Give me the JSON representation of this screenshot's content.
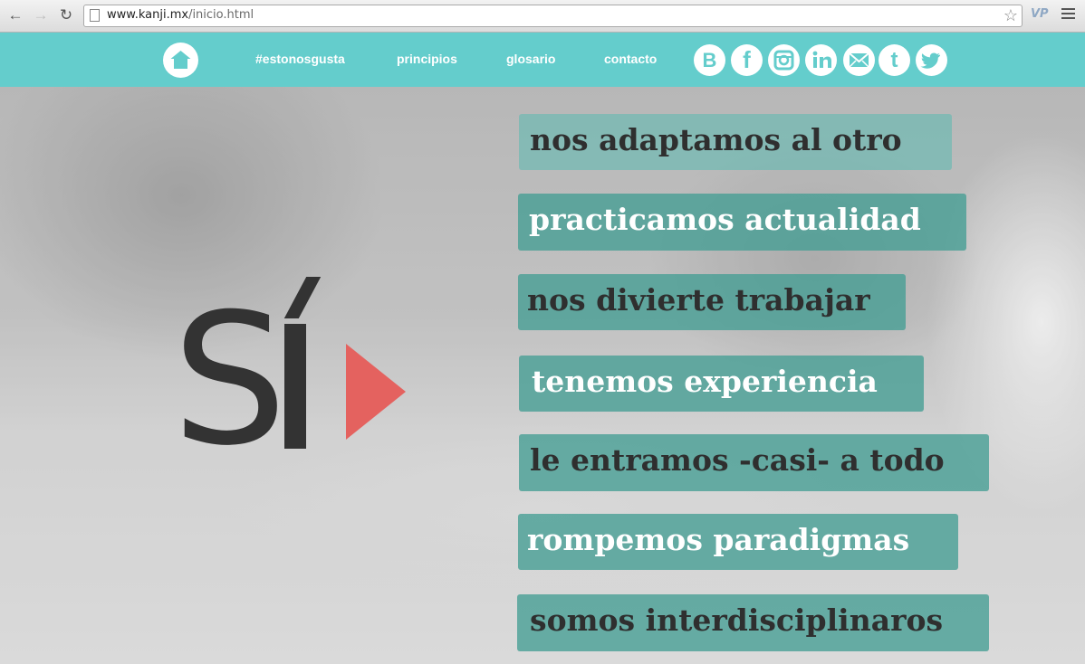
{
  "browser": {
    "url_host": "www.kanji.mx",
    "url_path": "/inicio.html",
    "back_icon": "←",
    "forward_icon": "→",
    "reload_icon": "↻",
    "star_icon": "☆",
    "extension_label": "VP"
  },
  "nav": {
    "links": [
      "#estonosgusta",
      "principios",
      "glosario",
      "contacto"
    ]
  },
  "social": {
    "blogger": "B",
    "facebook": "f",
    "tumblr": "t"
  },
  "logo": {
    "letter": "S"
  },
  "taglines": [
    "nos adaptamos al otro",
    "practicamos actualidad",
    "nos divierte trabajar",
    "tenemos experiencia",
    "le entramos -casi- a todo",
    "rompemos paradigmas",
    "somos interdisciplinaros"
  ],
  "colors": {
    "header": "#64cdcc",
    "tag": "#449e94",
    "logo_dark": "#333333",
    "logo_accent": "#e4625f"
  }
}
